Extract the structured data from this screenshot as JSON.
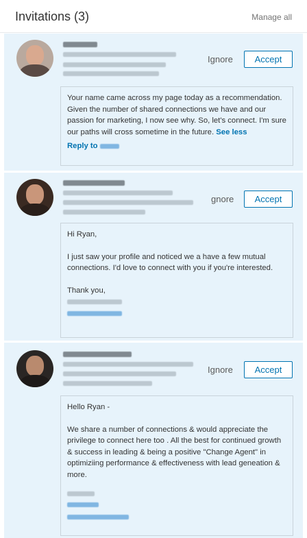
{
  "header": {
    "title": "Invitations (3)",
    "manage_label": "Manage all"
  },
  "invitations": [
    {
      "ignore_label": "Ignore",
      "accept_label": "Accept",
      "message": [
        "Your name came across my page today as a recommendation. Given the number of shared connections we have and our passion for marketing, I now see why. So, let's connect. I'm sure our paths will cross sometime in the future."
      ],
      "see_less_label": "See less",
      "reply_label": "Reply to"
    },
    {
      "ignore_label": "gnore",
      "accept_label": "Accept",
      "greeting": "Hi Ryan,",
      "message": [
        "I just saw your profile and noticed we a have a few mutual connections. I'd love to connect with you if you're interested."
      ],
      "sign_off": "Thank you,"
    },
    {
      "ignore_label": "Ignore",
      "accept_label": "Accept",
      "greeting": "Hello Ryan -",
      "message": [
        "We share a number of connections & would appreciate the privilege to connect here too . All the best for continued growth & success in leading & being a positive \"Change Agent\" in optimiziing performance & effectiveness with lead geneation & more."
      ]
    }
  ],
  "colors": {
    "accent": "#0073b1",
    "card_background": "#e7f3fb",
    "border": "#c9d3da"
  }
}
